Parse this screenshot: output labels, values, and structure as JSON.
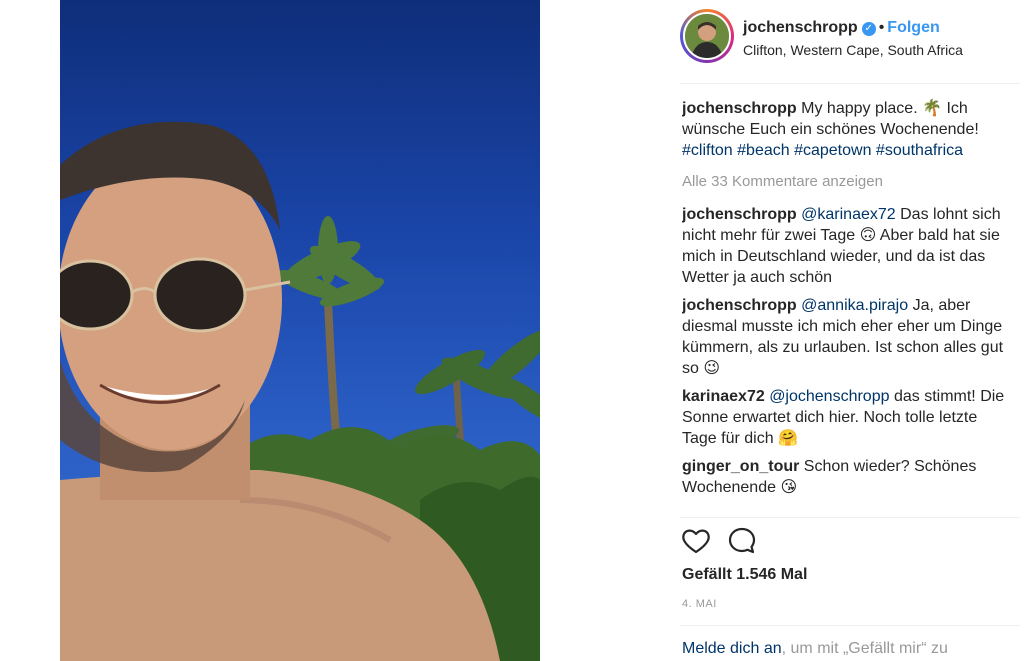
{
  "post": {
    "username": "jochenschropp",
    "verified_badge": "verified-icon",
    "separator": "•",
    "follow_label": "Folgen",
    "location": "Clifton, Western Cape, South Africa"
  },
  "caption": {
    "user": "jochenschropp",
    "text": "My happy place. 🌴 Ich wünsche Euch ein schönes Wochenende!",
    "hashtags": "#clifton #beach #capetown #southafrica"
  },
  "show_all_comments": "Alle 33 Kommentare anzeigen",
  "comments": [
    {
      "user": "jochenschropp",
      "mention": "@karinaex72",
      "text": "Das lohnt sich nicht mehr für zwei Tage 🙃 Aber bald hat sie mich in Deutschland wieder, und da ist das Wetter ja auch schön"
    },
    {
      "user": "jochenschropp",
      "mention": "@annika.pirajo",
      "text": "Ja, aber diesmal musste ich mich eher eher um Dinge kümmern, als zu urlauben. Ist schon alles gut so 😉"
    },
    {
      "user": "karinaex72",
      "mention": "@jochenschropp",
      "text": "das stimmt! Die Sonne erwartet dich hier. Noch tolle letzte Tage für dich 🤗"
    },
    {
      "user": "ginger_on_tour",
      "mention": "",
      "text": "Schon wieder? Schönes Wochenende 😘"
    }
  ],
  "actions": {
    "like_icon": "heart-icon",
    "comment_icon": "comment-bubble-icon"
  },
  "likes": "Gefällt 1.546 Mal",
  "date": "4. MAI",
  "login": {
    "link": "Melde dich an",
    "rest": ", um mit „Gefällt mir“ zu"
  },
  "colors": {
    "accent_blue": "#3897f0",
    "link_dark": "#003569",
    "muted": "#999999",
    "sky": "#1a45a8"
  }
}
